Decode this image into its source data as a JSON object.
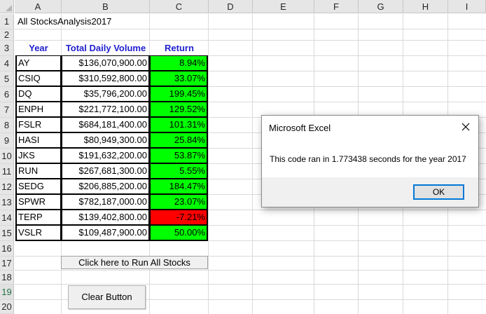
{
  "sheet": {
    "columns": [
      "A",
      "B",
      "C",
      "D",
      "E",
      "F",
      "G",
      "H",
      "I"
    ],
    "rows": [
      "1",
      "2",
      "3",
      "4",
      "5",
      "6",
      "7",
      "8",
      "9",
      "10",
      "11",
      "12",
      "13",
      "14",
      "15",
      "16",
      "17",
      "18",
      "19",
      "20"
    ],
    "title": "All StocksAnalysis2017",
    "headers": {
      "year": "Year",
      "volume": "Total Daily Volume",
      "return": "Return"
    },
    "table": [
      {
        "ticker": "AY",
        "volume": "$136,070,900.00",
        "return": "8.94%",
        "status": "positive"
      },
      {
        "ticker": "CSIQ",
        "volume": "$310,592,800.00",
        "return": "33.07%",
        "status": "positive"
      },
      {
        "ticker": "DQ",
        "volume": "$35,796,200.00",
        "return": "199.45%",
        "status": "positive"
      },
      {
        "ticker": "ENPH",
        "volume": "$221,772,100.00",
        "return": "129.52%",
        "status": "positive"
      },
      {
        "ticker": "FSLR",
        "volume": "$684,181,400.00",
        "return": "101.31%",
        "status": "positive"
      },
      {
        "ticker": "HASI",
        "volume": "$80,949,300.00",
        "return": "25.84%",
        "status": "positive"
      },
      {
        "ticker": "JKS",
        "volume": "$191,632,200.00",
        "return": "53.87%",
        "status": "positive"
      },
      {
        "ticker": "RUN",
        "volume": "$267,681,300.00",
        "return": "5.55%",
        "status": "positive"
      },
      {
        "ticker": "SEDG",
        "volume": "$206,885,200.00",
        "return": "184.47%",
        "status": "positive"
      },
      {
        "ticker": "SPWR",
        "volume": "$782,187,000.00",
        "return": "23.07%",
        "status": "positive"
      },
      {
        "ticker": "TERP",
        "volume": "$139,402,800.00",
        "return": "-7.21%",
        "status": "negative"
      },
      {
        "ticker": "VSLR",
        "volume": "$109,487,900.00",
        "return": "50.00%",
        "status": "positive"
      }
    ],
    "buttons": {
      "run_all": "Click here to Run All Stocks",
      "clear": "Clear Button"
    }
  },
  "dialog": {
    "title": "Microsoft Excel",
    "message": "This code ran in 1.773438 seconds for the year 2017",
    "ok_label": "OK",
    "close_icon": "close-icon"
  },
  "colors": {
    "positive": "#00ff00",
    "negative": "#ff0000",
    "header_text": "#1f1fd0",
    "accent": "#0078d7"
  }
}
